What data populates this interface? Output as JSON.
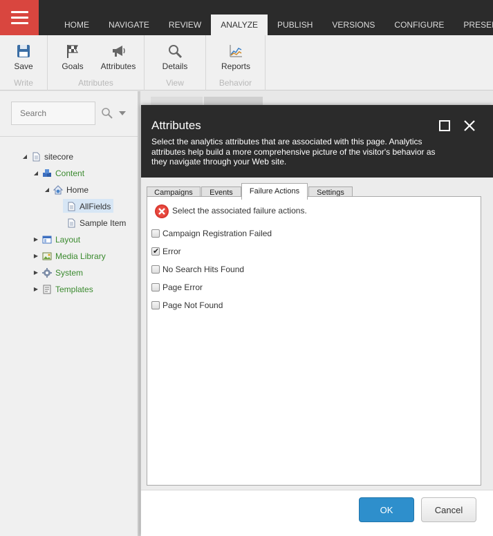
{
  "topbar": {
    "tabs": [
      {
        "label": "HOME"
      },
      {
        "label": "NAVIGATE"
      },
      {
        "label": "REVIEW"
      },
      {
        "label": "ANALYZE",
        "active": true
      },
      {
        "label": "PUBLISH"
      },
      {
        "label": "VERSIONS"
      },
      {
        "label": "CONFIGURE"
      },
      {
        "label": "PRESEN"
      }
    ]
  },
  "ribbon": {
    "groups": [
      {
        "label": "Write",
        "buttons": [
          {
            "label": "Save",
            "icon": "save-icon"
          }
        ]
      },
      {
        "label": "Attributes",
        "buttons": [
          {
            "label": "Goals",
            "icon": "flag-icon"
          },
          {
            "label": "Attributes",
            "icon": "megaphone-icon"
          }
        ]
      },
      {
        "label": "View",
        "buttons": [
          {
            "label": "Details",
            "icon": "magnifier-icon"
          }
        ]
      },
      {
        "label": "Behavior",
        "buttons": [
          {
            "label": "Reports",
            "icon": "chart-icon"
          }
        ]
      }
    ]
  },
  "tree": {
    "search_placeholder": "Search",
    "nodes": [
      {
        "label": "sitecore",
        "expanded": true
      },
      {
        "label": "Content",
        "expanded": true
      },
      {
        "label": "Home",
        "expanded": true
      },
      {
        "label": "AllFields",
        "selected": true
      },
      {
        "label": "Sample Item"
      },
      {
        "label": "Layout"
      },
      {
        "label": "Media Library"
      },
      {
        "label": "System"
      },
      {
        "label": "Templates"
      }
    ]
  },
  "dialog": {
    "title": "Attributes",
    "description": "Select the analytics attributes that are associated with this page. Analytics attributes help build a more comprehensive picture of the visitor's behavior as they navigate through your Web site.",
    "tabs": [
      {
        "label": "Campaigns"
      },
      {
        "label": "Events"
      },
      {
        "label": "Failure Actions",
        "active": true
      },
      {
        "label": "Settings"
      }
    ],
    "message": "Select the associated failure actions.",
    "options": [
      {
        "label": "Campaign Registration Failed",
        "checked": false
      },
      {
        "label": "Error",
        "checked": true
      },
      {
        "label": "No Search Hits Found",
        "checked": false
      },
      {
        "label": "Page Error",
        "checked": false
      },
      {
        "label": "Page Not Found",
        "checked": false
      }
    ],
    "ok_label": "OK",
    "cancel_label": "Cancel"
  },
  "colors": {
    "brand_red": "#d9463f",
    "topbar": "#2b2b2b",
    "ok_blue": "#2e8fcc",
    "tree_green": "#3a8a2e"
  }
}
